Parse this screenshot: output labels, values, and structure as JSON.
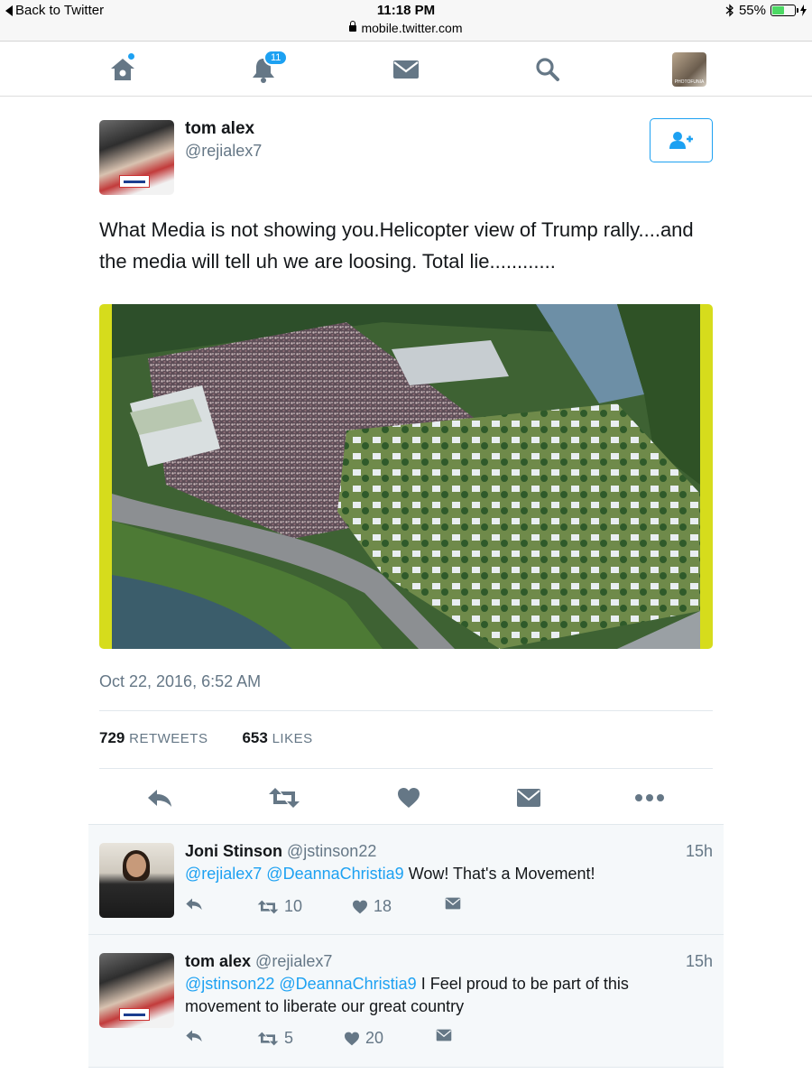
{
  "status_bar": {
    "back_label": "Back to Twitter",
    "time": "11:18 PM",
    "url": "mobile.twitter.com",
    "battery": "55%",
    "battery_level": 0.55
  },
  "nav": {
    "notifications_count": "11",
    "profile_avatar_text": "PHOTOFUNIA"
  },
  "tweet": {
    "author_name": "tom alex",
    "author_handle": "@rejialex7",
    "text": "What Media is not showing you.Helicopter view of Trump rally....and the media will tell uh we are loosing. Total lie............",
    "timestamp": "Oct 22, 2016, 6:52 AM",
    "retweets_count": "729",
    "retweets_label": "RETWEETS",
    "likes_count": "653",
    "likes_label": "LIKES",
    "avatar_sign_text": "TRUMP"
  },
  "replies": [
    {
      "name": "Joni Stinson",
      "handle": "@jstinson22",
      "time": "15h",
      "mentions": "@rejialex7 @DeannaChristia9",
      "text": "Wow!  That's a Movement!",
      "retweets": "10",
      "likes": "18"
    },
    {
      "name": "tom alex",
      "handle": "@rejialex7",
      "time": "15h",
      "mentions": "@jstinson22 @DeannaChristia9",
      "text": "I Feel proud to be part of this movement to liberate our great country",
      "retweets": "5",
      "likes": "20"
    }
  ],
  "colors": {
    "accent": "#1da1f2",
    "icon_gray": "#657786",
    "reply_bg": "#f5f8fa",
    "media_frame": "#d6dc1c"
  }
}
